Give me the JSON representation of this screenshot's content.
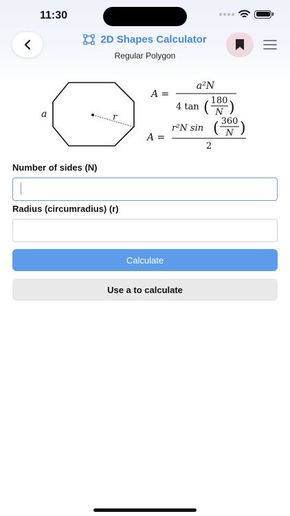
{
  "status_bar": {
    "time": "11:30"
  },
  "header": {
    "title": "2D Shapes Calculator",
    "subtitle": "Regular Polygon"
  },
  "diagram": {
    "side_label": "a",
    "radius_label": "r"
  },
  "formulas": {
    "f1_lhs": "A =",
    "f1_num": "a²N",
    "f1_den_prefix": "4 tan",
    "f1_frac_num": "180",
    "f1_frac_den": "N",
    "f2_lhs": "A =",
    "f2_num_prefix": "r²N sin",
    "f2_frac_num": "360",
    "f2_frac_den": "N",
    "f2_den": "2"
  },
  "form": {
    "sides_label": "Number of sides (N)",
    "sides_value": "",
    "radius_label": "Radius (circumradius) (r)",
    "radius_value": ""
  },
  "buttons": {
    "calculate": "Calculate",
    "use_a": "Use a to calculate"
  },
  "colors": {
    "accent": "#4a86d9",
    "calculate_bg": "#5c9ce8",
    "bookmark_bg": "#f0d9de"
  }
}
